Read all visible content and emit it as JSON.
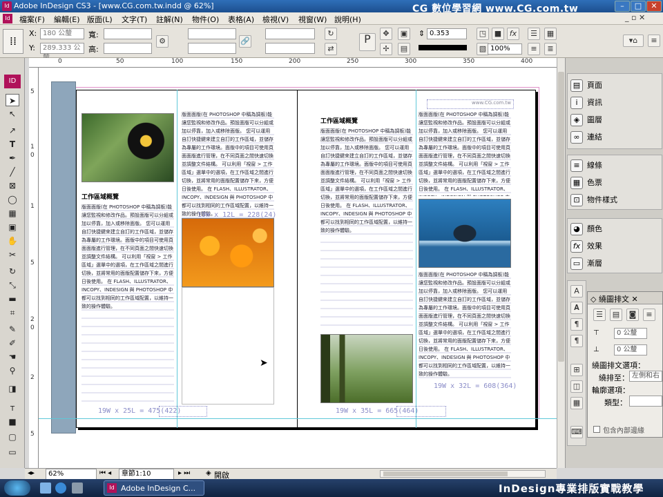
{
  "window": {
    "title": "Adobe InDesign CS3 - [www.CG.com.tw.indd @ 62%]",
    "watermark": "CG 數位學習網 www.CG.com.tw",
    "app_icon": "Id"
  },
  "menu": [
    "檔案(F)",
    "編輯(E)",
    "版面(L)",
    "文字(T)",
    "註解(N)",
    "物件(O)",
    "表格(A)",
    "檢視(V)",
    "視窗(W)",
    "說明(H)"
  ],
  "control": {
    "x_label": "X:",
    "x_value": "180 公釐",
    "y_label": "Y:",
    "y_value": "289.333 公釐",
    "w_label": "寬:",
    "h_label": "高:",
    "stroke_value": "0.353",
    "zoom_pct": "100%"
  },
  "ruler_top": [
    "0",
    "50",
    "100",
    "150",
    "200",
    "250",
    "300",
    "350",
    "400"
  ],
  "ruler_left": [
    "5",
    "1",
    "0",
    "1",
    "5",
    "2",
    "0",
    "2",
    "5"
  ],
  "document": {
    "heading_left": "工作區域概覽",
    "heading_right": "工作區域概覽",
    "body_text": "版面面版(在 PHOTOSHOP 中稱為調板)能讓您監視和修改作品。預設面版可以分組或加以停靠，加入或移除面版。 您可以運用自訂快捷鍵來建立自訂的工作區域，並儲存為專屬的工作環境。面版中的項目可使用頁面面版進行管理，在不同頁面之間快速切換並調整文件結構。 可以利用「視窗 > 工作區域」選單中的選項，在工作區域之間進行切換，並將常用的面版配置儲存下來，方便日後使用。 在 FLASH、ILLUSTRATOR、INCOPY、INDESIGN 與 PHOTOSHOP 中都可以找到相同的工作區域配置，以維持一致的操作體驗。",
    "caption_left": "19W x 25L = 475(422)",
    "caption_mid": "19W x 12L = 228(24)",
    "caption_right_bottom": "19W x 35L = 665(464)",
    "caption_right_col": "19W x 32L = 608(364)",
    "frame_note": "www.CG.com.tw"
  },
  "panels": {
    "group1": [
      "頁面",
      "資訊",
      "圖層",
      "連結"
    ],
    "group2": [
      "線條",
      "色票",
      "物件樣式"
    ],
    "group3": [
      "顏色",
      "效果",
      "漸層"
    ]
  },
  "wrap_panel": {
    "title": "繞圖排文",
    "offset_top": "0 公釐",
    "offset_bottom": "0 公釐",
    "options_label": "繞圖排文選項：",
    "wrap_to_label": "繞排至：",
    "wrap_to_value": "左側和右",
    "contour_label": "輪廓選項：",
    "type_label": "類型：",
    "include_edges": "包含內部邊緣"
  },
  "status": {
    "zoom": "62%",
    "page": "章節1:10",
    "state": "開啟"
  },
  "taskbar": {
    "app_button": "Adobe InDesign C...",
    "banner": "InDesign專業排版實戰教學"
  }
}
